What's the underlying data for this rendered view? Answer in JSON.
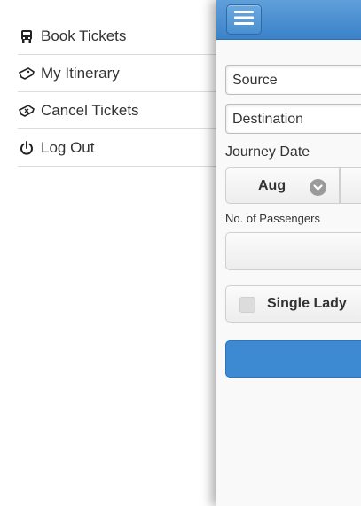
{
  "menu": {
    "items": [
      {
        "label": "Book Tickets",
        "icon": "bus-icon"
      },
      {
        "label": "My Itinerary",
        "icon": "ticket-icon"
      },
      {
        "label": "Cancel Tickets",
        "icon": "cancel-ticket-icon"
      },
      {
        "label": "Log Out",
        "icon": "power-icon"
      }
    ]
  },
  "form": {
    "source_placeholder": "Source",
    "destination_placeholder": "Destination",
    "journey_date_label": "Journey Date",
    "month_selected": "Aug",
    "passengers_label": "No. of Passengers",
    "single_lady_label": "Single Lady"
  },
  "colors": {
    "header": "#3b82c9",
    "submit": "#3d8ad2"
  }
}
